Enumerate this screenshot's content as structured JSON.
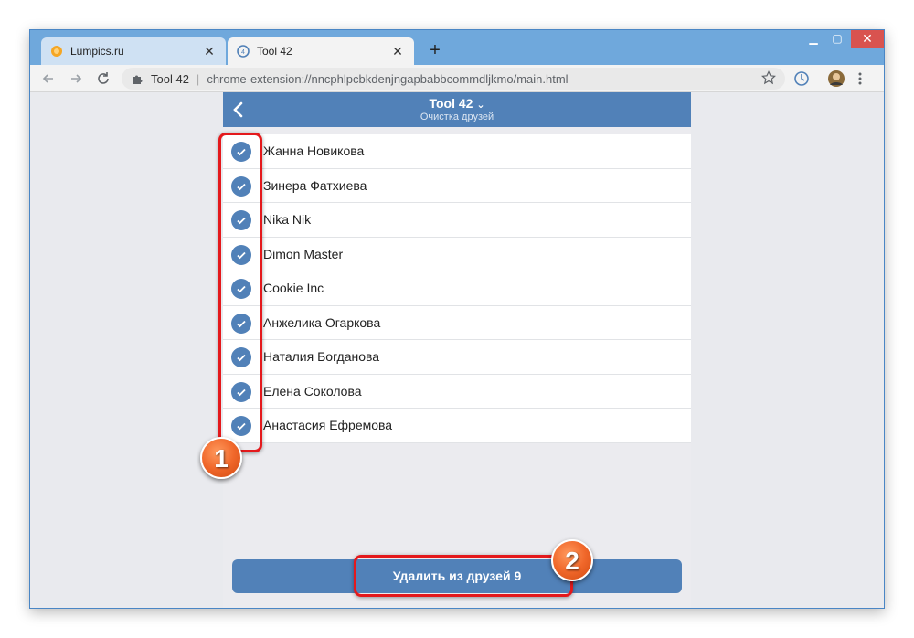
{
  "browser": {
    "tabs": [
      {
        "title": "Lumpics.ru",
        "icon": "lumpics-favicon"
      },
      {
        "title": "Tool 42",
        "icon": "tool42-favicon"
      }
    ],
    "new_tab_label": "+",
    "omnibox": {
      "site_label": "Tool 42",
      "url": "chrome-extension://nncphlpcbkdenjngapbabbcommdljkmo/main.html"
    }
  },
  "app": {
    "title": "Tool 42",
    "subtitle": "Очистка друзей",
    "accent_color": "#5181b8",
    "friends": [
      {
        "name": "Жанна Новикова",
        "checked": true
      },
      {
        "name": "Зинера Фатхиева",
        "checked": true
      },
      {
        "name": "Nika Nik",
        "checked": true
      },
      {
        "name": "Dimon Master",
        "checked": true
      },
      {
        "name": "Cookie Inc",
        "checked": true
      },
      {
        "name": "Анжелика Огаркова",
        "checked": true
      },
      {
        "name": "Наталия Богданова",
        "checked": true
      },
      {
        "name": "Елена Соколова",
        "checked": true
      },
      {
        "name": "Анастасия Ефремова",
        "checked": true
      }
    ],
    "delete_button_label": "Удалить из друзей 9"
  },
  "annotations": {
    "marker_1": "1",
    "marker_2": "2",
    "highlight_color": "#e4191c"
  }
}
